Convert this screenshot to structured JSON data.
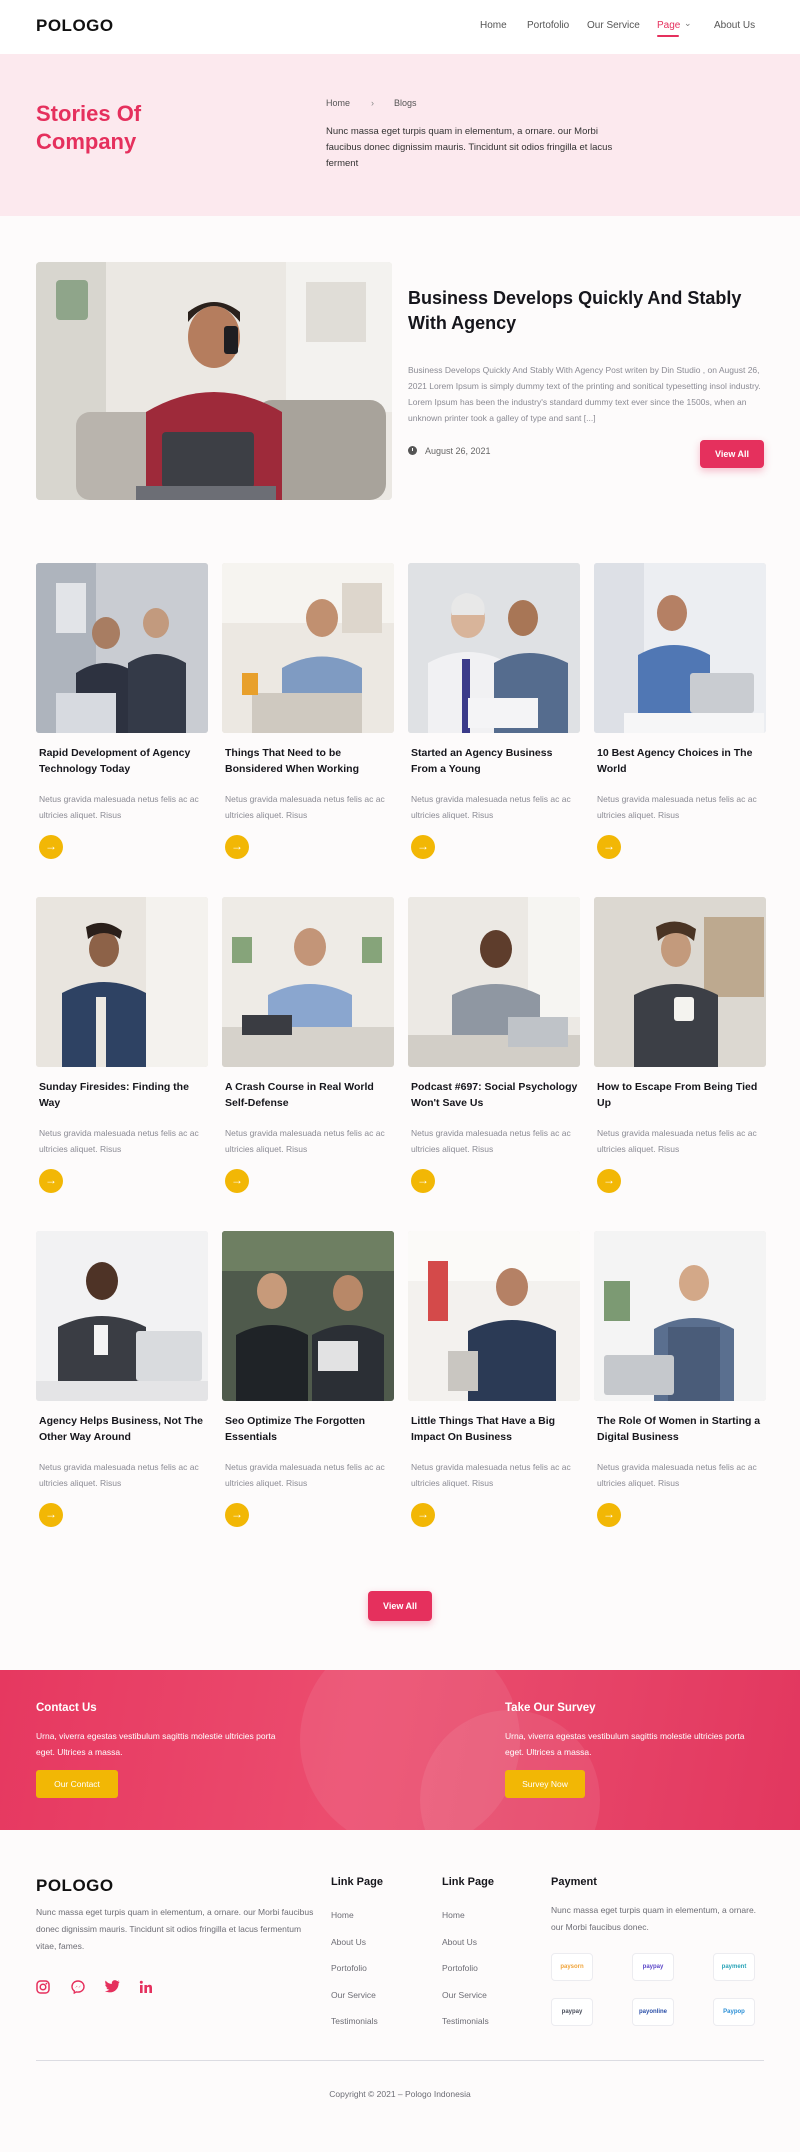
{
  "header": {
    "logo": "POLOGO",
    "nav": [
      {
        "label": "Home"
      },
      {
        "label": "Portofolio"
      },
      {
        "label": "Our Service"
      },
      {
        "label": "Page",
        "active": true
      },
      {
        "label": "About Us"
      }
    ]
  },
  "hero": {
    "title": "Stories Of Company",
    "breadcrumb": [
      "Home",
      "Blogs"
    ],
    "description": "Nunc massa eget turpis quam in elementum, a ornare. our Morbi faucibus donec dignissim mauris. Tincidunt sit odios fringilla et lacus ferment"
  },
  "featured": {
    "title": "Business Develops Quickly And Stably With Agency",
    "description": "Business Develops Quickly And Stably With Agency Post writen by  Din Studio , on August 26, 2021 Lorem Ipsum is simply dummy text of the printing and sonitical typesetting insol industry. Lorem Ipsum has been the industry's standard dummy text ever since the 1500s, when an unknown printer took a galley of type and sant [...]",
    "date": "August 26, 2021",
    "button_label": "View All"
  },
  "cards": [
    {
      "title": "Rapid Development of Agency Technology Today",
      "desc": "Netus gravida malesuada netus felis ac ac ultricies aliquet. Risus"
    },
    {
      "title": "Things That Need to be Bonsidered When Working",
      "desc": "Netus gravida malesuada netus felis ac ac ultricies aliquet. Risus"
    },
    {
      "title": "Started an Agency Business From a Young",
      "desc": "Netus gravida malesuada netus felis ac ac ultricies aliquet. Risus"
    },
    {
      "title": "10 Best Agency Choices in The World",
      "desc": "Netus gravida malesuada netus felis ac ac ultricies aliquet. Risus"
    },
    {
      "title": "Sunday Firesides: Finding the Way",
      "desc": "Netus gravida malesuada netus felis ac ac ultricies aliquet. Risus"
    },
    {
      "title": "A Crash Course in Real World Self-Defense",
      "desc": "Netus gravida malesuada netus felis ac ac ultricies aliquet. Risus"
    },
    {
      "title": "Podcast #697: Social Psychology Won't Save Us",
      "desc": "Netus gravida malesuada netus felis ac ac ultricies aliquet. Risus"
    },
    {
      "title": "How to Escape From Being Tied Up",
      "desc": "Netus gravida malesuada netus felis ac ac ultricies aliquet. Risus"
    },
    {
      "title": "Agency Helps Business, Not The Other Way Around",
      "desc": "Netus gravida malesuada netus felis ac ac ultricies aliquet. Risus"
    },
    {
      "title": "Seo Optimize The Forgotten Essentials",
      "desc": "Netus gravida malesuada netus felis ac ac ultricies aliquet. Risus"
    },
    {
      "title": "Little Things That Have a Big Impact On Business",
      "desc": "Netus gravida malesuada netus felis ac ac ultricies aliquet. Risus"
    },
    {
      "title": "The Role Of Women in Starting a Digital Business",
      "desc": "Netus gravida malesuada netus felis ac ac ultricies aliquet. Risus"
    }
  ],
  "view_all_label": "View All",
  "cta": {
    "contact": {
      "title": "Contact Us",
      "text": "Urna, viverra egestas vestibulum sagittis molestie ultricies porta eget. Ultrices a massa.",
      "button": "Our Contact"
    },
    "survey": {
      "title": "Take Our Survey",
      "text": "Urna, viverra egestas vestibulum sagittis molestie ultricies porta eget. Ultrices a massa.",
      "button": "Survey Now"
    }
  },
  "footer": {
    "logo": "POLOGO",
    "description": "Nunc massa eget turpis quam in elementum, a ornare. our Morbi faucibus donec dignissim mauris. Tincidunt sit odios fringilla et lacus fermentum vitae, fames.",
    "social_icons": [
      "instagram-icon",
      "messenger-icon",
      "twitter-icon",
      "linkedin-icon"
    ],
    "link_col_1": {
      "title": "Link Page",
      "links": [
        "Home",
        "About Us",
        "Portofolio",
        "Our Service",
        "Testimonials"
      ]
    },
    "link_col_2": {
      "title": "Link Page",
      "links": [
        "Home",
        "About Us",
        "Portofolio",
        "Our Service",
        "Testimonials"
      ]
    },
    "payment": {
      "title": "Payment",
      "text": "Nunc massa eget turpis quam in elementum, a ornare. our Morbi faucibus donec.",
      "badges": [
        "paysorn",
        "paypay",
        "payment",
        "paypay",
        "payonline",
        "Paypop"
      ]
    },
    "copyright": "Copyright © 2021 – Pologo Indonesia"
  },
  "colors": {
    "accent": "#e5305d",
    "hero_bg": "#fce9ee",
    "arrow_button": "#f2b705"
  }
}
